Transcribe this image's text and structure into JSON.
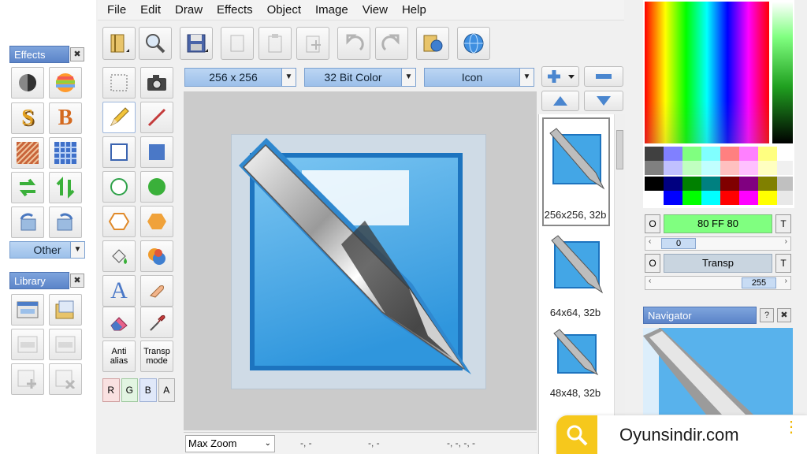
{
  "menu": [
    "File",
    "Edit",
    "Draw",
    "Effects",
    "Object",
    "Image",
    "View",
    "Help"
  ],
  "effects_panel": {
    "title": "Effects",
    "other_label": "Other"
  },
  "library_panel": {
    "title": "Library"
  },
  "tools": {
    "anti_alias": "Anti alias",
    "transp_mode": "Transp mode",
    "channels": [
      "R",
      "G",
      "B",
      "A"
    ]
  },
  "format": {
    "size": "256 x 256",
    "color_depth": "32 Bit Color",
    "type": "Icon"
  },
  "thumbnails": [
    "256x256, 32b",
    "64x64, 32b",
    "48x48, 32b"
  ],
  "color_controls": {
    "left_label": "O",
    "right_label": "T",
    "primary_hex": "80 FF 80",
    "primary_alpha": "0",
    "secondary": "Transp",
    "secondary_alpha": "255"
  },
  "navigator": {
    "title": "Navigator",
    "help_label": "?"
  },
  "status": {
    "zoom": "Max Zoom",
    "field1": "-, -",
    "field2": "-, -",
    "field3": "-, -, -, -"
  },
  "watermark": {
    "text": "Oyunsindir.com"
  },
  "colors": {
    "primary_swatch": "#80ff80",
    "panel_header": "#5b84c9",
    "canvas_blue": "#3aa3e3"
  }
}
